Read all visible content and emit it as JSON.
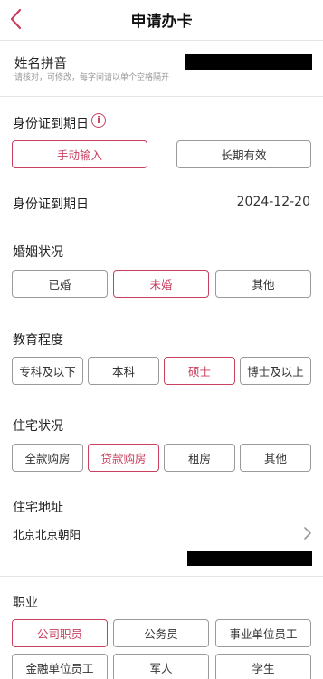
{
  "header": {
    "title": "申请办卡"
  },
  "name_pinyin": {
    "label": "姓名拼音",
    "hint": "请核对，可修改，每字间请以单个空格隔开"
  },
  "id_expiry": {
    "label": "身份证到期日",
    "options": [
      "手动输入",
      "长期有效"
    ],
    "selected": 0,
    "date_label": "身份证到期日",
    "date_value": "2024-12-20"
  },
  "marital": {
    "label": "婚姻状况",
    "options": [
      "已婚",
      "未婚",
      "其他"
    ],
    "selected": 1
  },
  "education": {
    "label": "教育程度",
    "options": [
      "专科及以下",
      "本科",
      "硕士",
      "博士及以上"
    ],
    "selected": 2
  },
  "housing": {
    "label": "住宅状况",
    "options": [
      "全款购房",
      "贷款购房",
      "租房",
      "其他"
    ],
    "selected": 1
  },
  "address": {
    "label": "住宅地址",
    "region": "北京北京朝阳"
  },
  "occupation": {
    "label": "职业",
    "options": [
      "公司职员",
      "公务员",
      "事业单位员工",
      "金融单位员工",
      "军人",
      "学生"
    ],
    "selected": 0
  },
  "colors": {
    "accent": "#c9405f",
    "border": "#9a9a9a",
    "divider": "#e4e4e4"
  }
}
